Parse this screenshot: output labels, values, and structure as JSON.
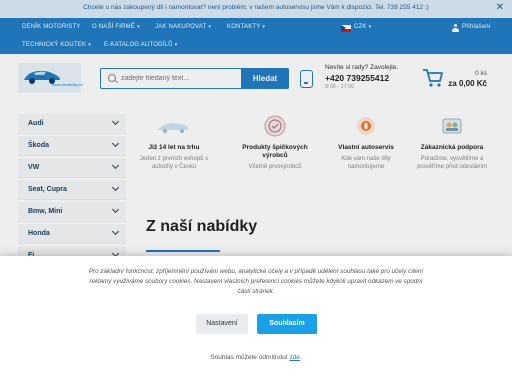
{
  "topbar": {
    "message": "Chcete u nás zakoupený díl i namontovat? není problém, v našem autoservisu jsme Vám k dispozici. Tel. 739 255 412 :)",
    "close_icon": "close-icon"
  },
  "nav": {
    "items": [
      {
        "label": "DENÍK MOTORISTY",
        "dropdown": false
      },
      {
        "label": "O NAŠÍ FIRMĚ",
        "dropdown": true
      },
      {
        "label": "JAK NAKUPOVAT",
        "dropdown": true
      },
      {
        "label": "KONTAKTY",
        "dropdown": true
      },
      {
        "label": "TECHNICKÝ KOUTEK",
        "dropdown": true
      },
      {
        "label": "E-KATALOG AUTODÍLŮ",
        "dropdown": true
      }
    ],
    "currency": "CZK",
    "login": "Přihlášení",
    "color": "#1f7cc4"
  },
  "header": {
    "logo_text": "www.sezdnilby.cz",
    "search_placeholder": "zadejte hledaný text...",
    "search_button": "Hledat",
    "contact_line1": "Nevíte si rady? Zavolejte.",
    "contact_phone": "+420 739255412",
    "contact_hours": "8:00 - 17:00",
    "cart_count": "0 ks",
    "cart_total": "za 0,00 Kč"
  },
  "sidebar": {
    "items": [
      {
        "label": "Audi"
      },
      {
        "label": "Škoda"
      },
      {
        "label": "VW"
      },
      {
        "label": "Seat, Cupra"
      },
      {
        "label": "Bmw, Mini"
      },
      {
        "label": "Honda"
      },
      {
        "label": "Fi..."
      }
    ]
  },
  "features": [
    {
      "icon": "shop-logo-icon",
      "title": "Již 14 let na trhu",
      "desc": "Jeden z prvních eshopů s autodíly v Česku"
    },
    {
      "icon": "quality-seal-icon",
      "title": "Produkty špičkových výrobců",
      "desc": "Včetně prvovýrobců"
    },
    {
      "icon": "service-icon",
      "title": "Vlastní autoservis",
      "desc": "Kde vám naše díly namontujeme"
    },
    {
      "icon": "support-icon",
      "title": "Zákaznická podpora",
      "desc": "Poradíme, vysvětlíme a prověříme před odesláním"
    }
  ],
  "main": {
    "offer_title": "Z naší nabídky"
  },
  "cookie": {
    "text": "Pro základní funkčnost, zpříjemnění používání webu, analytické účely a v případě udělení souhlasu také pro účely cílení reklamy využíváme soubory cookies. Nastavení vlastních preferencí cookies můžete kdykoli upravit odkazem ve spodní části stránek.",
    "settings_button": "Nastavení",
    "accept_button": "Souhlasím",
    "revoke_text": "Souhlas můžete odmítnout",
    "revoke_link": "zde",
    "revoke_end": "."
  }
}
